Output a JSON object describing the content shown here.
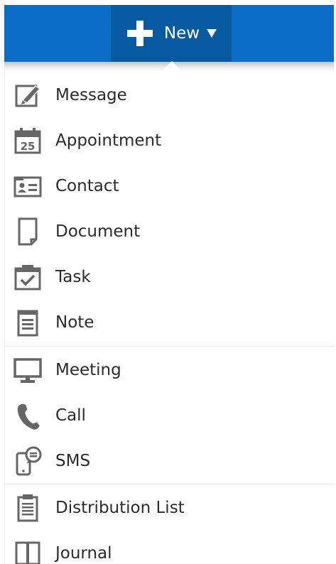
{
  "toolbar": {
    "new_label": "New",
    "accent_color": "#0a6ec8",
    "button_color": "#085aa0"
  },
  "menu": {
    "items": [
      {
        "label": "Message",
        "icon": "message-icon"
      },
      {
        "label": "Appointment",
        "icon": "calendar-icon",
        "icon_text": "25"
      },
      {
        "label": "Contact",
        "icon": "contact-card-icon"
      },
      {
        "label": "Document",
        "icon": "document-icon"
      },
      {
        "label": "Task",
        "icon": "task-icon"
      },
      {
        "label": "Note",
        "icon": "note-icon"
      },
      {
        "label": "Meeting",
        "icon": "meeting-icon"
      },
      {
        "label": "Call",
        "icon": "phone-icon"
      },
      {
        "label": "SMS",
        "icon": "sms-icon"
      },
      {
        "label": "Distribution List",
        "icon": "distribution-list-icon"
      },
      {
        "label": "Journal",
        "icon": "journal-icon"
      }
    ]
  }
}
